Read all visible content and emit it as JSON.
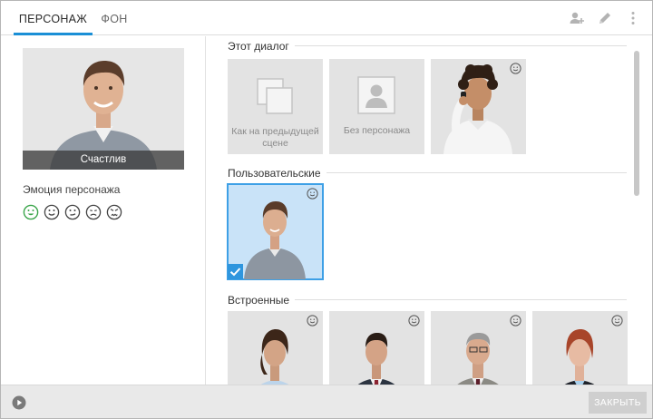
{
  "tabs": [
    {
      "label": "ПЕРСОНАЖ",
      "active": true
    },
    {
      "label": "ФОН",
      "active": false
    }
  ],
  "header_icons": [
    "add-user-icon",
    "pencil-icon",
    "more-vertical-icon"
  ],
  "left": {
    "portrait_caption": "Счастлив",
    "emotion_label": "Эмоция персонажа",
    "emotions": [
      "happy-icon",
      "smile-icon",
      "neutral-icon",
      "sad-icon",
      "angry-icon"
    ],
    "selected_emotion": "happy-icon"
  },
  "sections": {
    "this_dialog": {
      "title": "Этот диалог",
      "items": [
        {
          "label": "Как на предыдущей сцене",
          "icon": "copy-icon"
        },
        {
          "label": "Без персонажа",
          "icon": "no-person-icon"
        },
        {
          "label": "",
          "icon": "person-phone"
        }
      ]
    },
    "custom": {
      "title": "Пользовательские"
    },
    "builtin": {
      "title": "Встроенные"
    }
  },
  "footer": {
    "close_label": "ЗАКРЫТЬ"
  },
  "colors": {
    "accent": "#1a8fd6",
    "selected_bg": "#c9e3f8",
    "tile_bg": "#e3e3e3",
    "emotion_selected": "#3aa54a"
  }
}
